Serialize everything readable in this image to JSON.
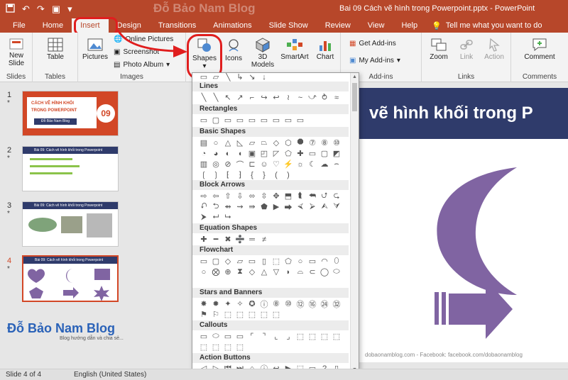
{
  "titlebar": {
    "watermark": "Đỗ Bảo Nam Blog",
    "title": "Bai 09 Cách vẽ hình trong Powerpoint.pptx  -  PowerPoint",
    "qa_icons": [
      "save-icon",
      "undo-icon",
      "redo-icon",
      "present-icon",
      "customize-icon"
    ]
  },
  "tabs": [
    "File",
    "Home",
    "Insert",
    "Design",
    "Transitions",
    "Animations",
    "Slide Show",
    "Review",
    "View",
    "Help"
  ],
  "active_tab": "Insert",
  "tellme": "Tell me what you want to do",
  "ribbon": {
    "slides": {
      "new_slide": "New",
      "new_slide2": "Slide",
      "group": "Slides"
    },
    "tables": {
      "table": "Table",
      "group": "Tables"
    },
    "images": {
      "pictures": "Pictures",
      "online_pictures": "Online Pictures",
      "screenshot": "Screenshot",
      "photo_album": "Photo Album",
      "group": "Images"
    },
    "illustrations": {
      "shapes": "Shapes",
      "icons": "Icons",
      "models": "3D",
      "models2": "Models",
      "smartart": "SmartArt",
      "chart": "Chart"
    },
    "addins": {
      "get": "Get Add-ins",
      "my": "My Add-ins",
      "group": "Add-ins"
    },
    "links": {
      "zoom": "Zoom",
      "link": "Link",
      "action": "Action",
      "group": "Links"
    },
    "comments": {
      "comment": "Comment",
      "group": "Comments"
    }
  },
  "shape_categories": [
    "Lines",
    "Rectangles",
    "Basic Shapes",
    "Block Arrows",
    "Equation Shapes",
    "Flowchart",
    "Stars and Banners",
    "Callouts",
    "Action Buttons"
  ],
  "shape_glyphs": {
    "recent": "▭ ▱ ╲ ↳ ↘ ↓",
    "lines": "╲ ╲ ↖ ↗ ⌐ ↪ ↩ ≀ ~ ⤻ ⥁ ≈",
    "rectangles": "▭ ▢ ▭ ▭ ▭ ▭ ▭ ▭ ▭",
    "basic1": "▤ ○ △ ◺ ▱ ⏢ ◇ ⬡ ⯃ ⑦ ⑧ ⑩",
    "basic2": "◔ ◕ ◐ ◖ ▣ ◰ ◸ ⬠ ✚ ▭ ▢ ◩",
    "basic3": "▥ ◎ ⊘ ⌒ ⊏ ☺ ♡ ⚡ ☼ ☾ ☁ ⌢",
    "basic4": "❲ ❳ ⁅ ⁆ { } ( )",
    "arrows1": "⇨ ⇦ ⇧ ⇩ ⬄ ⇳ ✥ ⬒ ⮬ ⮪ ⮍ ⮎",
    "arrows2": "⮏ ⮌ ⇴ ⇝ ⇛ ⬟ ▶ ⮕ ⮘ ⮚ ⮙ ⮛",
    "arrows3": "⮞ ⮠ ⮡",
    "equation": "✚ ━ ✖ ➗ ═ ≠",
    "flow1": "▭ ▢ ◇ ▱ ▭ ▯ ⬚ ⬠ ○ ▭ ◠ ⬯",
    "flow2": "○ ⨂ ⊕ ⧗ ◇ △ ▽ ◗ ⌓ ⊂ ◯ ⬭",
    "stars1": "✸ ✹ ✦ ✧ ✪ ⓘ ⑧ ⑩ ⑫ ⑯ ㉔ ㉜",
    "stars2": "⚑ ⚐ ⬚ ⬚ ⬚ ⬚ ⬚",
    "callouts1": "▭ ⬭ ▭ ▭ ⌜ ⌝ ⌞ ⌟ ⬚ ⬚ ⬚ ⬚",
    "callouts2": "⬚ ⬚ ⬚ ⬚",
    "actions": "◁ ▷ ⏮ ⏭ ⌂ ⓘ ↩ ▶ ⬚ ▭ ? ▯"
  },
  "slides": [
    {
      "num": "1",
      "title": "CÁCH VẼ HÌNH KHỐI",
      "sub": "TRONG POWERPOINT",
      "badge": "09",
      "author": "Đỗ Bảo Nam Blog"
    },
    {
      "num": "2",
      "header": "Bài 09: Cách vẽ hình khối trong Powerpoint"
    },
    {
      "num": "3",
      "header": "Bài 09: Cách vẽ hình khối trong Powerpoint"
    },
    {
      "num": "4",
      "header": "Bài 09: Cách vẽ hình khối trong Powerpoint"
    }
  ],
  "brand": {
    "name": "Đỗ Bảo Nam Blog",
    "sub": "Blog hướng dẫn và chia sẻ..."
  },
  "main_slide": {
    "title": "vẽ hình khối trong P",
    "footer": "dobaonamblog.com - Facebook: facebook.com/dobaonamblog"
  },
  "status": {
    "slide": "Slide 4 of 4",
    "language": "English (United States)"
  },
  "colors": {
    "accent": "#b7472a",
    "slide_header": "#2f3b6b",
    "shape_purple": "#8064a2",
    "highlight": "#e01e1e"
  }
}
